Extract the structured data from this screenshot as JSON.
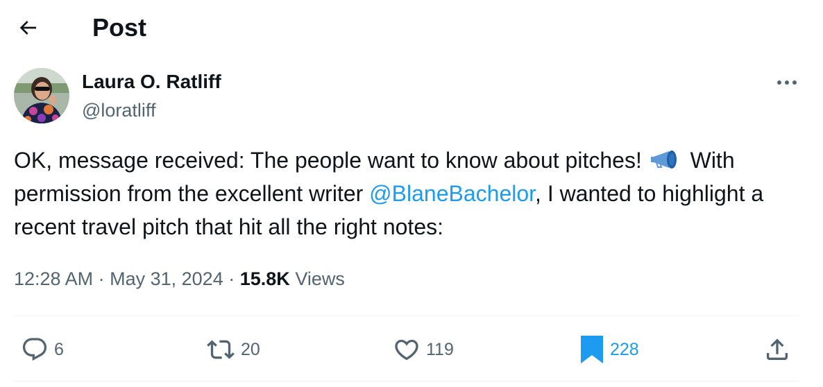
{
  "header": {
    "title": "Post",
    "back_icon": "arrow-left-icon"
  },
  "author": {
    "name": "Laura O. Ratliff",
    "handle": "@loratliff",
    "avatar_icon": "avatar"
  },
  "tweet": {
    "text_part1": "OK, message received: The people want to know about pitches!",
    "emoji": "megaphone-emoji",
    "text_part2": "With permission from the excellent writer ",
    "mention": "@BlaneBachelor",
    "text_part3": ", I wanted to highlight a recent travel pitch that hit all the right notes:"
  },
  "meta": {
    "time": "12:28 AM",
    "separator1": "·",
    "date": "May 31, 2024",
    "separator2": "·",
    "views_count": "15.8K",
    "views_label": "Views"
  },
  "actions": {
    "replies": "6",
    "reposts": "20",
    "likes": "119",
    "bookmarks": "228"
  },
  "colors": {
    "accent": "#1d9bf0",
    "text": "#0f1419",
    "muted": "#536471",
    "divider": "#eff3f4"
  }
}
